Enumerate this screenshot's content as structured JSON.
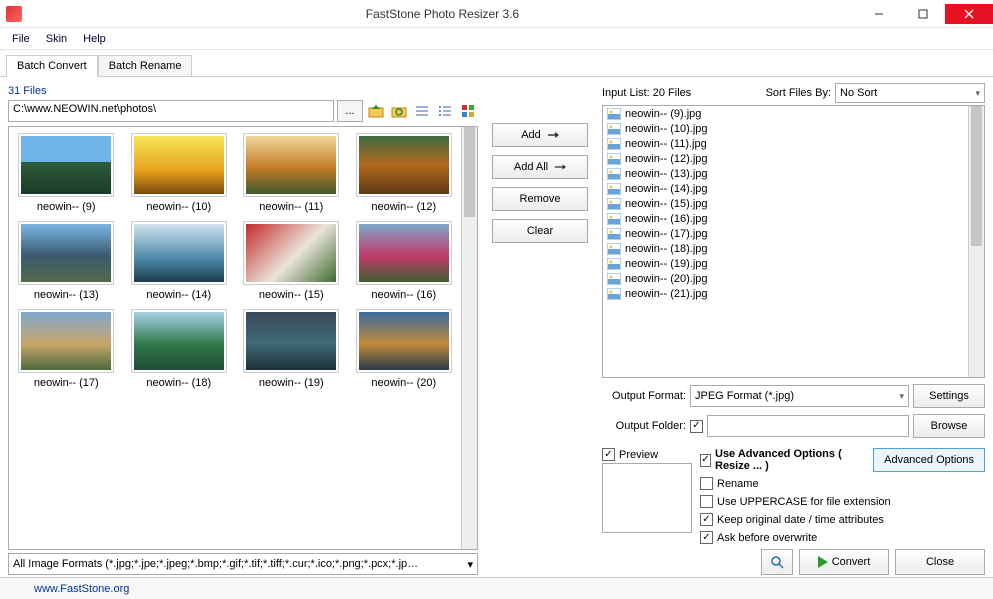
{
  "title": "FastStone Photo Resizer 3.6",
  "menu": [
    "File",
    "Skin",
    "Help"
  ],
  "tabs": {
    "convert": "Batch Convert",
    "rename": "Batch Rename"
  },
  "fileCount": "31 Files",
  "path": "C:\\www.NEOWIN.net\\photos\\",
  "pathBrowse": "...",
  "thumbs": [
    {
      "name": "neowin-- (9)",
      "bg": "linear-gradient(180deg,#6fb6e8 0%,#6fb6e8 45%,#2f5d3d 45%,#1a3a28 100%)"
    },
    {
      "name": "neowin-- (10)",
      "bg": "linear-gradient(180deg,#f9e65a 0%,#e7a11c 60%,#7a4a0e 100%)"
    },
    {
      "name": "neowin-- (11)",
      "bg": "linear-gradient(180deg,#efd79a 0%,#c47a26 55%,#3e5a2b 100%)"
    },
    {
      "name": "neowin-- (12)",
      "bg": "linear-gradient(180deg,#3f6a42 0%,#b36a1f 50%,#5e3a17 100%)"
    },
    {
      "name": "neowin-- (13)",
      "bg": "linear-gradient(180deg,#79b6e4 0%,#3c5a70 55%,#526a4a 100%)"
    },
    {
      "name": "neowin-- (14)",
      "bg": "linear-gradient(180deg,#cfe3ec 0%,#4a88a8 60%,#1f3d4e 100%)"
    },
    {
      "name": "neowin-- (15)",
      "bg": "linear-gradient(135deg,#c42a2a 0%,#e9e4da 55%,#3f6b2e 100%)"
    },
    {
      "name": "neowin-- (16)",
      "bg": "linear-gradient(180deg,#7ea7c9 0%,#c23a6a 55%,#3f5d2e 100%)"
    },
    {
      "name": "neowin-- (17)",
      "bg": "linear-gradient(180deg,#7fa8d0 0%,#c9a66a 55%,#4e6a3e 100%)"
    },
    {
      "name": "neowin-- (18)",
      "bg": "linear-gradient(180deg,#a8d0e6 0%,#2f7a4a 55%,#1f4a36 100%)"
    },
    {
      "name": "neowin-- (19)",
      "bg": "linear-gradient(180deg,#3a4a5a 0%,#406a76 55%,#1f3038 100%)"
    },
    {
      "name": "neowin-- (20)",
      "bg": "linear-gradient(180deg,#3c6aa0 0%,#c28a3a 55%,#2a3a4a 100%)"
    }
  ],
  "filter": "All Image Formats (*.jpg;*.jpe;*.jpeg;*.bmp;*.gif;*.tif;*.tiff;*.cur;*.ico;*.png;*.pcx;*.jp…",
  "buttons": {
    "add": "Add",
    "addAll": "Add All",
    "remove": "Remove",
    "clear": "Clear"
  },
  "inputList": {
    "label": "Input List:  20 Files",
    "sortLabel": "Sort Files By:",
    "sortValue": "No Sort",
    "items": [
      "neowin-- (9).jpg",
      "neowin-- (10).jpg",
      "neowin-- (11).jpg",
      "neowin-- (12).jpg",
      "neowin-- (13).jpg",
      "neowin-- (14).jpg",
      "neowin-- (15).jpg",
      "neowin-- (16).jpg",
      "neowin-- (17).jpg",
      "neowin-- (18).jpg",
      "neowin-- (19).jpg",
      "neowin-- (20).jpg",
      "neowin-- (21).jpg"
    ]
  },
  "output": {
    "formatLabel": "Output Format:",
    "formatValue": "JPEG Format (*.jpg)",
    "settings": "Settings",
    "folderLabel": "Output Folder:",
    "browse": "Browse"
  },
  "previewLabel": "Preview",
  "options": {
    "advanced": "Use Advanced Options ( Resize ... )",
    "advBtn": "Advanced Options",
    "rename": "Rename",
    "uppercase": "Use UPPERCASE for file extension",
    "keepDate": "Keep original date / time attributes",
    "askOverwrite": "Ask before overwrite"
  },
  "convert": "Convert",
  "close": "Close",
  "status": "www.FastStone.org"
}
